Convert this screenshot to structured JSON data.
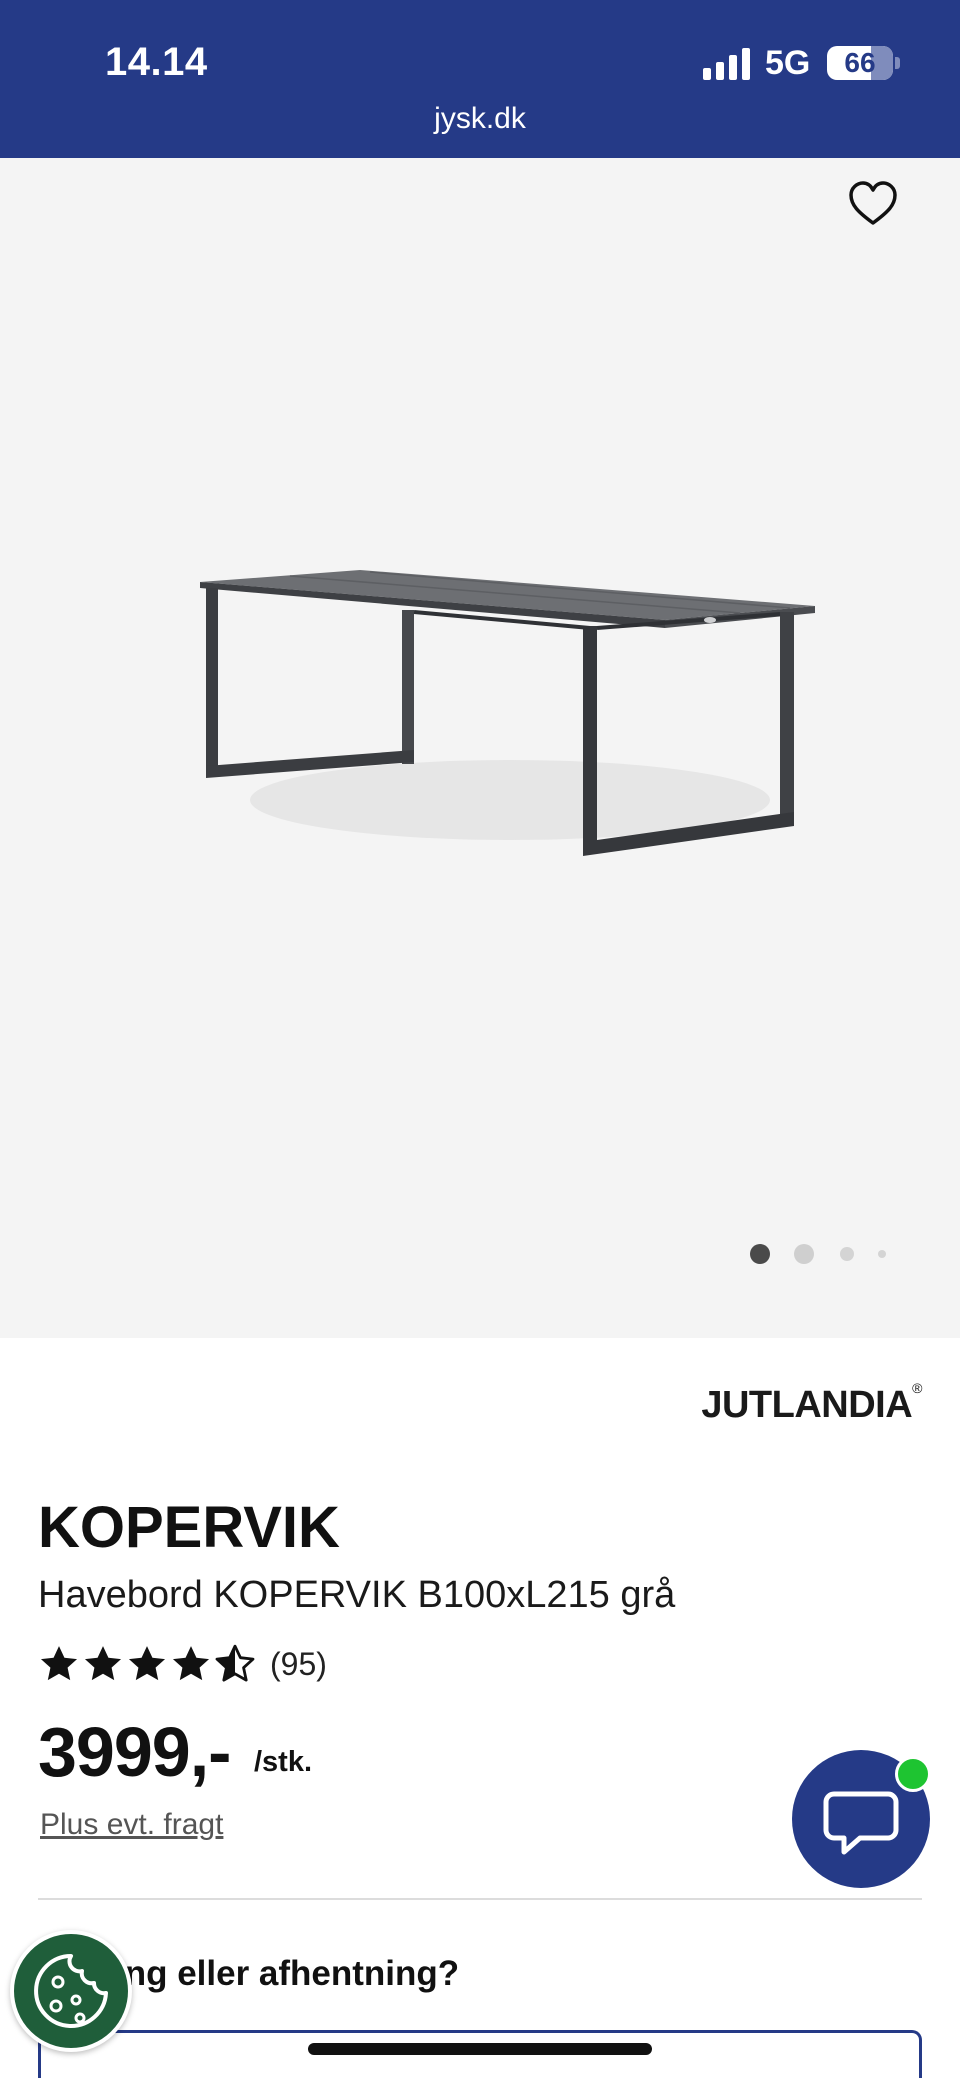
{
  "status_bar": {
    "time": "14.14",
    "network": "5G",
    "battery": "66",
    "battery_level": 0.66
  },
  "browser": {
    "url": "jysk.dk"
  },
  "gallery": {
    "favorite_icon": "heart-outline-icon",
    "image_description_icon": "garden-table-image",
    "slides": 4,
    "active_slide": 1
  },
  "product": {
    "brand": "JUTLANDIA",
    "brand_mark": "®",
    "name": "KOPERVIK",
    "description": "Havebord KOPERVIK B100xL215 grå",
    "rating_value": 4.5,
    "rating_max": 5,
    "rating_count": "(95)",
    "price": "3999,-",
    "price_unit": "/stk.",
    "freight_link": "Plus evt. fragt"
  },
  "delivery": {
    "question": "ing eller afhentning?"
  },
  "colors": {
    "brand_blue": "#253a87",
    "online_green": "#1ec431",
    "cookie_green": "#1f5e3a"
  }
}
